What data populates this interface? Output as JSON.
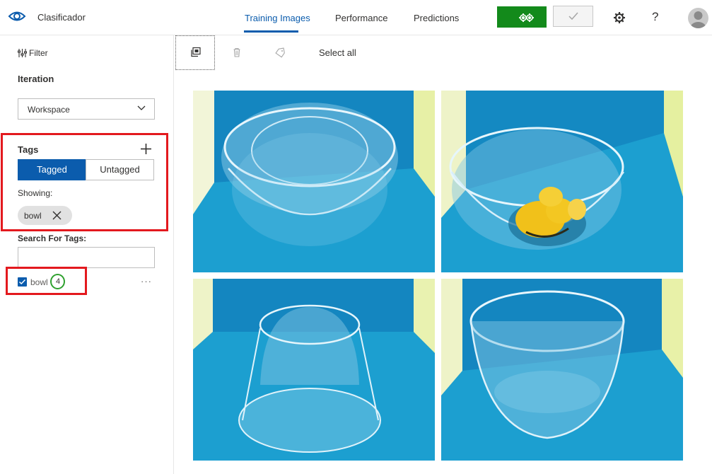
{
  "app": {
    "title": "Clasificador",
    "logo_icon": "eye-icon"
  },
  "nav": {
    "tabs": [
      {
        "label": "Training Images",
        "active": true
      },
      {
        "label": "Performance",
        "active": false
      },
      {
        "label": "Predictions",
        "active": false
      }
    ],
    "train_icon": "gears-icon",
    "quick_test_icon": "checkmark-icon",
    "settings_icon": "gear-icon",
    "help_label": "?",
    "avatar_icon": "user-avatar-icon"
  },
  "colors": {
    "accent": "#0b5cad",
    "train_button": "#138a1b",
    "highlight_red": "#e3191e",
    "highlight_green": "#2ea02e"
  },
  "sidebar": {
    "filter_label": "Filter",
    "iteration_label": "Iteration",
    "iteration_value": "Workspace",
    "tags_label": "Tags",
    "tagged_label": "Tagged",
    "untagged_label": "Untagged",
    "tagged_selected": true,
    "showing_label": "Showing:",
    "showing_chip": "bowl",
    "search_label": "Search For Tags:",
    "search_value": "",
    "tag_list": [
      {
        "name": "bowl",
        "count": "4",
        "checked": true
      }
    ],
    "more_label": "···"
  },
  "toolbar": {
    "icons": [
      "copy-icon",
      "trash-icon",
      "tag-icon"
    ],
    "select_all_label": "Select all"
  },
  "images": [
    {
      "subject": "empty clear bowl with lid"
    },
    {
      "subject": "clear bowl with lemon peels"
    },
    {
      "subject": "upside-down clear bowl"
    },
    {
      "subject": "empty clear bowl"
    }
  ]
}
